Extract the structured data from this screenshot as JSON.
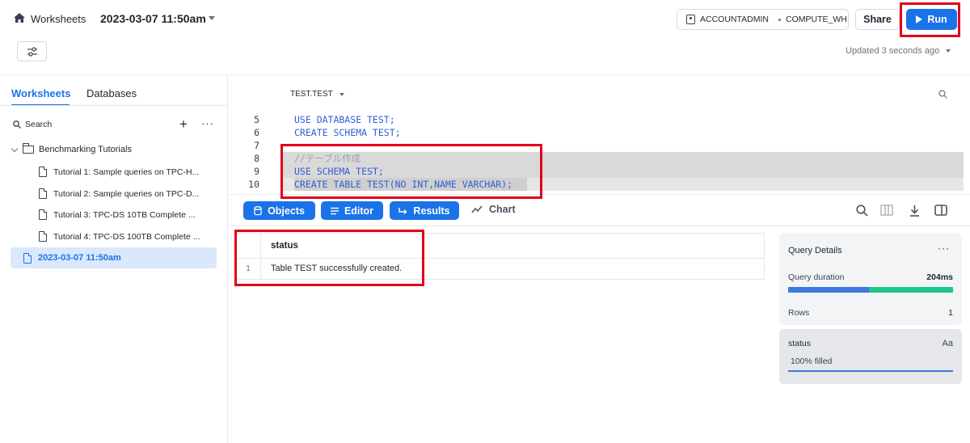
{
  "header": {
    "worksheets_label": "Worksheets",
    "worksheet_name": "2023-03-07 11:50am",
    "role": "ACCOUNTADMIN",
    "warehouse": "COMPUTE_WH",
    "share_label": "Share",
    "run_label": "Run",
    "updated_text": "Updated 3 seconds ago"
  },
  "sidebar": {
    "tabs": [
      "Worksheets",
      "Databases"
    ],
    "search_label": "Search",
    "folder": "Benchmarking Tutorials",
    "items": [
      "Tutorial 1: Sample queries on TPC-H...",
      "Tutorial 2: Sample queries on TPC-D...",
      "Tutorial 3: TPC-DS 10TB Complete ...",
      "Tutorial 4: TPC-DS 100TB Complete ..."
    ],
    "active_item": "2023-03-07 11:50am"
  },
  "editor": {
    "context": "TEST.TEST",
    "lines": [
      {
        "num": "5",
        "text": "USE DATABASE TEST;"
      },
      {
        "num": "6",
        "text": "CREATE SCHEMA TEST;"
      },
      {
        "num": "7",
        "text": ""
      },
      {
        "num": "8",
        "text": "//テーブル作成"
      },
      {
        "num": "9",
        "text": "USE SCHEMA TEST;"
      },
      {
        "num": "10",
        "text": "CREATE TABLE TEST(NO INT,NAME VARCHAR);"
      }
    ]
  },
  "toolbar": {
    "objects": "Objects",
    "editor": "Editor",
    "results": "Results",
    "chart": "Chart"
  },
  "results": {
    "column": "status",
    "rows": [
      {
        "idx": "1",
        "value": "Table TEST successfully created."
      }
    ]
  },
  "query_details": {
    "title": "Query Details",
    "duration_label": "Query duration",
    "duration_value": "204ms",
    "duration_split": [
      0.49,
      0.51
    ],
    "rows_label": "Rows",
    "rows_value": "1"
  },
  "status_panel": {
    "title": "status",
    "type": "Aa",
    "fill_text": "100% filled",
    "fill_fraction": 1.0
  },
  "colors": {
    "accent": "#1a73e8",
    "highlight": "#e0001b"
  }
}
